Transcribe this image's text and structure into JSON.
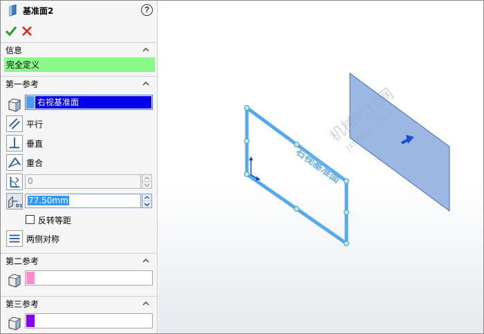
{
  "panel": {
    "title": "基准面2",
    "help_glyph": "?",
    "icons": {
      "feature": "plane-icon",
      "help": "help-icon",
      "ok": "checkmark-icon",
      "cancel": "x-icon"
    },
    "info_section": {
      "label": "信息",
      "status": "完全定义",
      "status_color": "#89fa89"
    },
    "first_reference": {
      "label": "第一参考",
      "selection": "右视基准面",
      "swatch_color": "#4d9cf0",
      "options": [
        {
          "label": "平行",
          "icon": "parallel-icon"
        },
        {
          "label": "垂直",
          "icon": "perpendicular-icon"
        },
        {
          "label": "重合",
          "icon": "coincident-icon"
        }
      ],
      "angle_value": "0",
      "offset_value": "77.50mm",
      "flip_label": "反转等距",
      "flip_checked": false,
      "mid_plane_label": "两侧对称"
    },
    "second_reference": {
      "label": "第二参考",
      "selection": "",
      "swatch_color": "#ff8ccc"
    },
    "third_reference": {
      "label": "第三参考",
      "selection": "",
      "swatch_color": "#8800ee"
    }
  },
  "viewport": {
    "reference_plane_label": "右视基准面",
    "watermark_line1": "机械时代网",
    "watermark_line2": "jxsdage.com",
    "plane_edge_color": "#55aaee",
    "preview_plane_color": "#8aaadd"
  }
}
